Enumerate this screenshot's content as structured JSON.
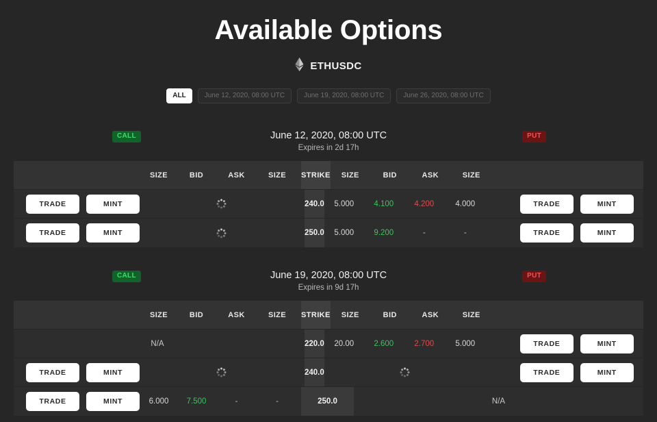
{
  "header": {
    "title": "Available Options",
    "pair": "ETHUSDC",
    "pair_icon": "ethereum-icon"
  },
  "filters": [
    {
      "label": "ALL",
      "active": true
    },
    {
      "label": "June 12, 2020, 08:00 UTC",
      "active": false
    },
    {
      "label": "June 19, 2020, 08:00 UTC",
      "active": false
    },
    {
      "label": "June 26, 2020, 08:00 UTC",
      "active": false
    }
  ],
  "labels": {
    "call_badge": "CALL",
    "put_badge": "PUT",
    "trade": "TRADE",
    "mint": "MINT",
    "na": "N/A",
    "dash": "-"
  },
  "columns": {
    "call": [
      "SIZE",
      "BID",
      "ASK",
      "SIZE"
    ],
    "strike": "STRIKE",
    "put": [
      "SIZE",
      "BID",
      "ASK",
      "SIZE"
    ]
  },
  "sections": [
    {
      "expiry": "June 12, 2020, 08:00 UTC",
      "expires_in": "Expires in 2d 17h",
      "rows": [
        {
          "strike": "240.0",
          "call": {
            "state": "loading"
          },
          "put": {
            "state": "quotes",
            "size1": "5.000",
            "bid": "4.100",
            "ask": "4.200",
            "size2": "4.000",
            "buttons": true
          }
        },
        {
          "strike": "250.0",
          "call": {
            "state": "loading"
          },
          "put": {
            "state": "quotes",
            "size1": "5.000",
            "bid": "9.200",
            "ask": "-",
            "size2": "-",
            "buttons": true
          }
        }
      ]
    },
    {
      "expiry": "June 19, 2020, 08:00 UTC",
      "expires_in": "Expires in 9d 17h",
      "rows": [
        {
          "strike": "220.0",
          "call": {
            "state": "na"
          },
          "put": {
            "state": "quotes",
            "size1": "20.00",
            "bid": "2.600",
            "ask": "2.700",
            "size2": "5.000",
            "buttons": true
          }
        },
        {
          "strike": "240.0",
          "call": {
            "state": "loading"
          },
          "put": {
            "state": "loading"
          }
        },
        {
          "strike": "250.0",
          "call": {
            "state": "quotes",
            "size1": "6.000",
            "bid": "7.500",
            "ask": "-",
            "size2": "-",
            "buttons": true
          },
          "put": {
            "state": "na"
          }
        }
      ]
    }
  ],
  "colors": {
    "background": "#262626",
    "table": "#2d2d2d",
    "table_header": "#333333",
    "strike_column": "#3a3a3a",
    "bid_green": "#35c759",
    "ask_red": "#e04b4b",
    "call_badge_bg": "#116329",
    "call_badge_text": "#3ddc6b",
    "put_badge_bg": "#6b1414",
    "put_badge_text": "#f2535a",
    "button": "#ffffff"
  }
}
